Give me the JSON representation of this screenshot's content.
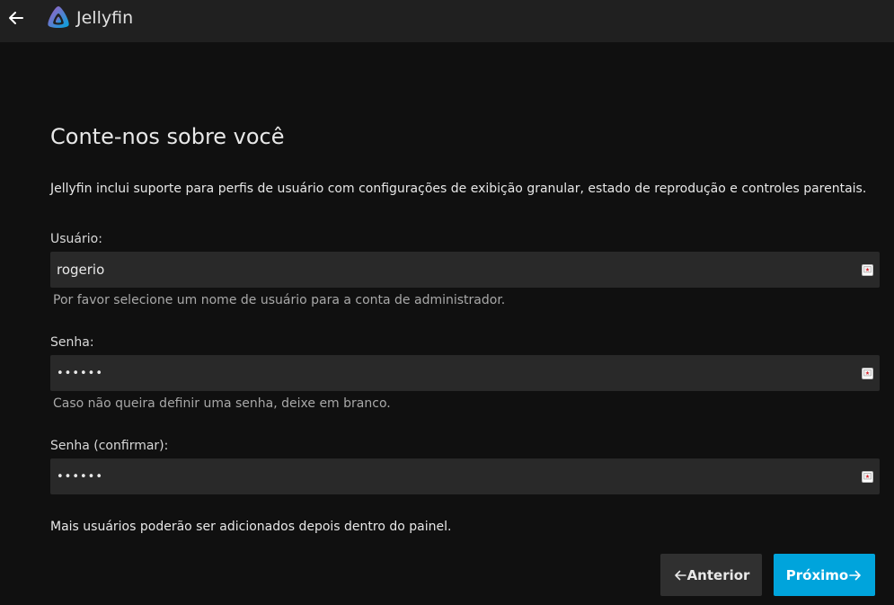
{
  "app": {
    "name": "Jellyfin",
    "back_icon": "arrow-left-icon",
    "logo_icon": "jellyfin-logo-icon"
  },
  "page": {
    "title": "Conte-nos sobre você",
    "intro": "Jellyfin inclui suporte para perfis de usuário com configurações de exibição granular, estado de reprodução e controles parentais."
  },
  "form": {
    "username": {
      "label": "Usuário:",
      "value": "rogerio",
      "help": "Por favor selecione um nome de usuário para a conta de administrador."
    },
    "password": {
      "label": "Senha:",
      "value": "••••••",
      "help": "Caso não queira definir uma senha, deixe em branco."
    },
    "password_confirm": {
      "label": "Senha (confirmar):",
      "value": "••••••"
    }
  },
  "footer": {
    "note": "Mais usuários poderão ser adicionados depois dentro do painel."
  },
  "buttons": {
    "previous": "Anterior",
    "next": "Próximo"
  },
  "colors": {
    "accent": "#00a4dc",
    "background": "#101010",
    "header": "#202020",
    "input": "#292929"
  }
}
